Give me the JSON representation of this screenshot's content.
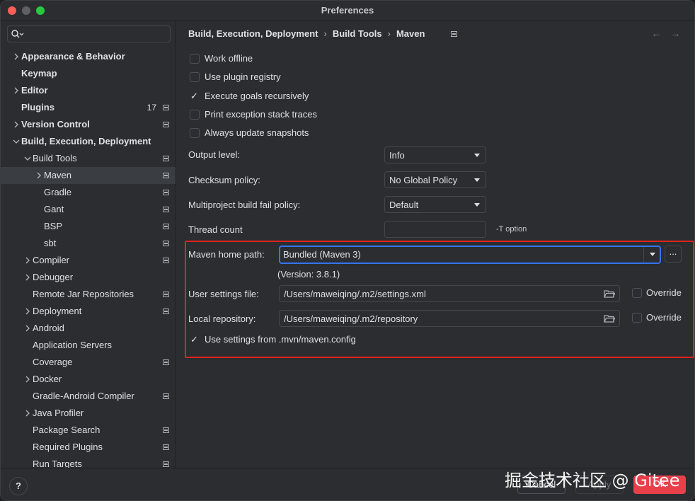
{
  "window": {
    "title": "Preferences"
  },
  "search": {
    "placeholder": "",
    "icon": "search-icon"
  },
  "tree": [
    {
      "label": "Appearance & Behavior",
      "bold": true,
      "level": 0,
      "chevron": "right",
      "badge": "",
      "project": false
    },
    {
      "label": "Keymap",
      "bold": true,
      "level": 0,
      "chevron": "",
      "badge": "",
      "project": false
    },
    {
      "label": "Editor",
      "bold": true,
      "level": 0,
      "chevron": "right",
      "badge": "",
      "project": false
    },
    {
      "label": "Plugins",
      "bold": true,
      "level": 0,
      "chevron": "",
      "badge": "17",
      "project": true
    },
    {
      "label": "Version Control",
      "bold": true,
      "level": 0,
      "chevron": "right",
      "badge": "",
      "project": true
    },
    {
      "label": "Build, Execution, Deployment",
      "bold": true,
      "level": 0,
      "chevron": "down",
      "badge": "",
      "project": false
    },
    {
      "label": "Build Tools",
      "bold": false,
      "level": 1,
      "chevron": "down",
      "badge": "",
      "project": true
    },
    {
      "label": "Maven",
      "bold": false,
      "level": 2,
      "chevron": "right",
      "badge": "",
      "project": true,
      "selected": true
    },
    {
      "label": "Gradle",
      "bold": false,
      "level": 2,
      "chevron": "",
      "badge": "",
      "project": true
    },
    {
      "label": "Gant",
      "bold": false,
      "level": 2,
      "chevron": "",
      "badge": "",
      "project": true
    },
    {
      "label": "BSP",
      "bold": false,
      "level": 2,
      "chevron": "",
      "badge": "",
      "project": true
    },
    {
      "label": "sbt",
      "bold": false,
      "level": 2,
      "chevron": "",
      "badge": "",
      "project": true
    },
    {
      "label": "Compiler",
      "bold": false,
      "level": 1,
      "chevron": "right",
      "badge": "",
      "project": true
    },
    {
      "label": "Debugger",
      "bold": false,
      "level": 1,
      "chevron": "right",
      "badge": "",
      "project": false
    },
    {
      "label": "Remote Jar Repositories",
      "bold": false,
      "level": 1,
      "chevron": "",
      "badge": "",
      "project": true
    },
    {
      "label": "Deployment",
      "bold": false,
      "level": 1,
      "chevron": "right",
      "badge": "",
      "project": true
    },
    {
      "label": "Android",
      "bold": false,
      "level": 1,
      "chevron": "right",
      "badge": "",
      "project": false
    },
    {
      "label": "Application Servers",
      "bold": false,
      "level": 1,
      "chevron": "",
      "badge": "",
      "project": false
    },
    {
      "label": "Coverage",
      "bold": false,
      "level": 1,
      "chevron": "",
      "badge": "",
      "project": true
    },
    {
      "label": "Docker",
      "bold": false,
      "level": 1,
      "chevron": "right",
      "badge": "",
      "project": false
    },
    {
      "label": "Gradle-Android Compiler",
      "bold": false,
      "level": 1,
      "chevron": "",
      "badge": "",
      "project": true
    },
    {
      "label": "Java Profiler",
      "bold": false,
      "level": 1,
      "chevron": "right",
      "badge": "",
      "project": false
    },
    {
      "label": "Package Search",
      "bold": false,
      "level": 1,
      "chevron": "",
      "badge": "",
      "project": true
    },
    {
      "label": "Required Plugins",
      "bold": false,
      "level": 1,
      "chevron": "",
      "badge": "",
      "project": true
    },
    {
      "label": "Run Targets",
      "bold": false,
      "level": 1,
      "chevron": "",
      "badge": "",
      "project": true
    }
  ],
  "breadcrumb": {
    "items": [
      "Build, Execution, Deployment",
      "Build Tools",
      "Maven"
    ],
    "sep": "›"
  },
  "nav": {
    "back": "←",
    "forward": "→"
  },
  "checkboxes": [
    {
      "label": "Work offline",
      "checked": false
    },
    {
      "label": "Use plugin registry",
      "checked": false
    },
    {
      "label": "Execute goals recursively",
      "checked": true
    },
    {
      "label": "Print exception stack traces",
      "checked": false
    },
    {
      "label": "Always update snapshots",
      "checked": false
    }
  ],
  "fields": {
    "output_level": {
      "label": "Output level:",
      "value": "Info"
    },
    "checksum_policy": {
      "label": "Checksum policy:",
      "value": "No Global Policy"
    },
    "fail_policy": {
      "label": "Multiproject build fail policy:",
      "value": "Default"
    },
    "thread_count": {
      "label": "Thread count",
      "value": "",
      "hint": "-T option"
    },
    "maven_home": {
      "label": "Maven home path:",
      "value": "Bundled (Maven 3)",
      "ellipsis": "...",
      "version": "(Version: 3.8.1)"
    },
    "user_settings": {
      "label": "User settings file:",
      "value": "/Users/maweiqing/.m2/settings.xml",
      "override": "Override"
    },
    "local_repo": {
      "label": "Local repository:",
      "value": "/Users/maweiqing/.m2/repository",
      "override": "Override"
    },
    "use_mvn_config": {
      "label": "Use settings from .mvn/maven.config",
      "checked": true
    }
  },
  "footer": {
    "help": "?",
    "cancel": "Cancel",
    "apply": "Apply",
    "ok": "OK"
  },
  "watermark": "掘金技术社区 @ Gitee",
  "colors": {
    "accent": "#3574f0",
    "highlight": "#e2231a",
    "ok": "#e8404b",
    "background": "#2b2d30"
  }
}
